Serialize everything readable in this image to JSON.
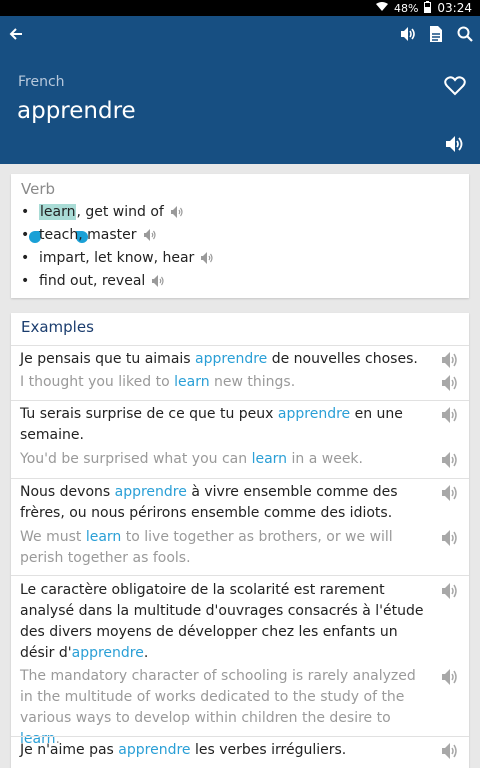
{
  "status": {
    "battery": "48%",
    "time": "03:24"
  },
  "header": {
    "language": "French",
    "word": "apprendre"
  },
  "entry": {
    "part_of_speech": "Verb",
    "senses": [
      {
        "text": "learn",
        "extra": ", get wind of"
      },
      {
        "text": "teach, master"
      },
      {
        "text": "impart, let know, hear"
      },
      {
        "text": "find out, reveal"
      }
    ]
  },
  "examples": {
    "title": "Examples",
    "items": [
      {
        "fr_pre": "Je pensais que tu aimais ",
        "fr_hl": "apprendre",
        "fr_post": " de nouvelles choses.",
        "en_pre": "I thought you liked to ",
        "en_hl": "learn",
        "en_post": " new things."
      },
      {
        "fr_pre": "Tu serais surprise de ce que tu peux ",
        "fr_hl": "apprendre",
        "fr_post": " en une semaine.",
        "en_pre": "You'd be surprised what you can ",
        "en_hl": "learn",
        "en_post": " in a week."
      },
      {
        "fr_pre": "Nous devons ",
        "fr_hl": "apprendre",
        "fr_post": " à vivre ensemble comme des frères, ou nous périrons ensemble comme des idiots.",
        "en_pre": "We must ",
        "en_hl": "learn",
        "en_post": " to live together as brothers, or we will perish together as fools."
      },
      {
        "fr_pre": "Le caractère obligatoire de la scolarité est rarement analysé dans la multitude d'ouvrages consacrés à l'étude des divers moyens de développer chez les enfants un désir d'",
        "fr_hl": "apprendre",
        "fr_post": ".",
        "en_pre": "The mandatory character of schooling is rarely analyzed in the multitude of works dedicated to the study of the various ways to develop within children the desire to ",
        "en_hl": "learn",
        "en_post": "."
      },
      {
        "fr_pre": "Je n'aime pas ",
        "fr_hl": "apprendre",
        "fr_post": " les verbes irréguliers.",
        "en_pre": "",
        "en_hl": "",
        "en_post": ""
      }
    ]
  }
}
